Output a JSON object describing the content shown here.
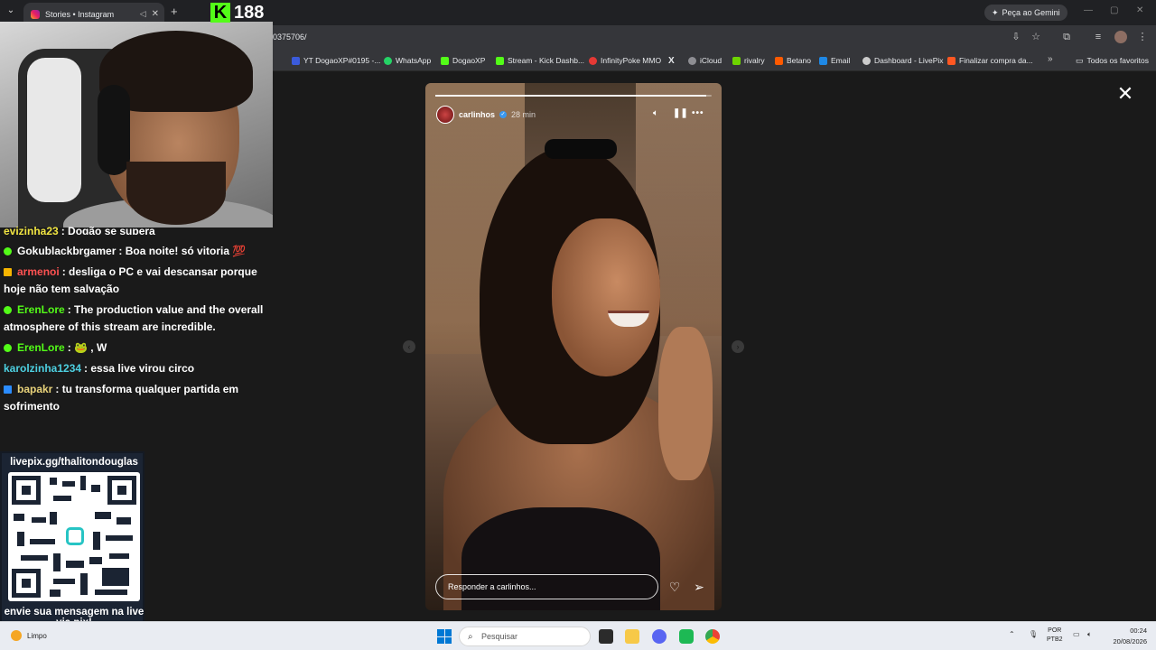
{
  "browser": {
    "tab_title": "Stories • Instagram",
    "new_tab_symbol": "+",
    "gemini_label": "Peça ao Gemini",
    "url": "0375706/",
    "bookmarks": [
      {
        "label": "YT DogaoXP#0195 -...",
        "color": "#3b5bdb"
      },
      {
        "label": "WhatsApp",
        "color": "#25d366"
      },
      {
        "label": "DogaoXP",
        "color": "#53fc18"
      },
      {
        "label": "Stream - Kick Dashb...",
        "color": "#53fc18"
      },
      {
        "label": "InfinityPoke MMO",
        "color": "#e53935"
      },
      {
        "label": "X",
        "color": "#000000"
      },
      {
        "label": "iCloud",
        "color": "#8e8e93"
      },
      {
        "label": "rivalry",
        "color": "#6dd400"
      },
      {
        "label": "Betano",
        "color": "#ff5a00"
      },
      {
        "label": "Email",
        "color": "#1e88e5"
      },
      {
        "label": "Dashboard - LivePix",
        "color": "#cccccc"
      },
      {
        "label": "Finalizar compra da...",
        "color": "#ff5722"
      }
    ],
    "all_bookmarks_label": "Todos os favoritos"
  },
  "story": {
    "username": "carlinhos",
    "time": "28 min",
    "progress": 0.98,
    "reply_placeholder": "Responder a carlinhos...",
    "icons": [
      "volume-icon",
      "pause-icon",
      "more-icon",
      "heart-icon",
      "send-icon",
      "close-icon"
    ]
  },
  "stream": {
    "kick_badge": "K",
    "viewer_count": "188",
    "chat": [
      {
        "user": "evizinha23",
        "text": ": Dogão se supera",
        "user_color": "#f0e442",
        "badge": ""
      },
      {
        "user": "Gokublackbrgamer",
        "text": ": Boa noite! só vitoria 💯",
        "user_color": "#ffffff",
        "badge": "green"
      },
      {
        "user": "armenoi",
        "text": ": desliga o PC e vai descansar porque hoje não tem salvação",
        "user_color": "#ff5252",
        "badge": "crown"
      },
      {
        "user": "ErenLore",
        "text": ": The production value and the overall atmosphere of this stream are incredible.",
        "user_color": "#53fc18",
        "badge": "green"
      },
      {
        "user": "ErenLore",
        "text": ": 🐸 , W",
        "user_color": "#53fc18",
        "badge": "green"
      },
      {
        "user": "karolzinha1234",
        "text": ": essa live virou circo",
        "user_color": "#4dd0e1",
        "badge": ""
      },
      {
        "user": "bapakr",
        "text": ": tu transforma qualquer partida em sofrimento",
        "user_color": "#e8d27a",
        "badge": "blue"
      }
    ],
    "qr_title": "livepix.gg/thalitondouglas",
    "qr_footer": "envie sua mensagem na live via pix!"
  },
  "taskbar": {
    "weather": "Limpo",
    "search_placeholder": "Pesquisar",
    "lang_top": "POR",
    "lang_bottom": "PTB2",
    "time": "00:24",
    "date": "20/08/2026"
  }
}
